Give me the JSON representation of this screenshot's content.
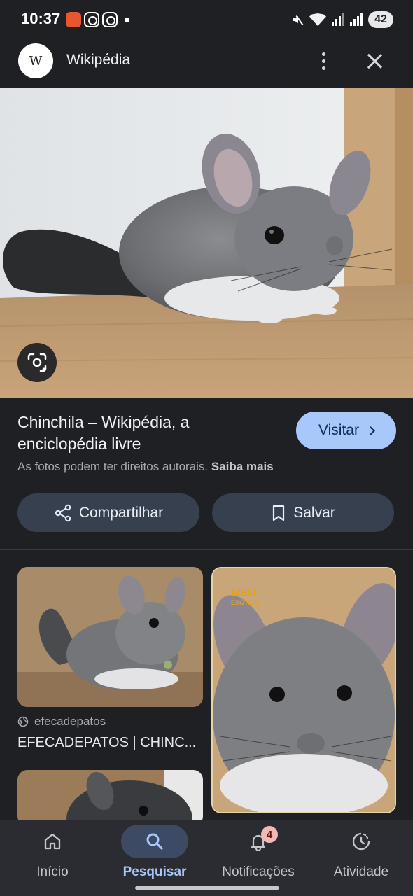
{
  "status_bar": {
    "time": "10:37",
    "battery": "42",
    "icons": [
      "app-notification-icon",
      "instagram-icon",
      "instagram-icon",
      "dot-icon",
      "mute-icon",
      "wifi-icon",
      "signal-icon",
      "signal-icon"
    ]
  },
  "header": {
    "logo_letter": "W",
    "title": "Wikipédia"
  },
  "result": {
    "title": "Chinchila – Wikipédia, a enciclopédia livre",
    "visit_label": "Visitar",
    "copyright_text": "As fotos podem ter direitos autorais.",
    "learn_more": "Saiba mais"
  },
  "actions": {
    "share_label": "Compartilhar",
    "save_label": "Salvar"
  },
  "related": {
    "item1": {
      "source": "efecadepatos",
      "title": "EFECADEPATOS | CHINC..."
    },
    "item2": {
      "overlay_logo_line1": "MEU",
      "overlay_logo_line2": "EXÓTICO"
    }
  },
  "nav": {
    "items": [
      {
        "label": "Início",
        "icon": "home-icon"
      },
      {
        "label": "Pesquisar",
        "icon": "search-icon"
      },
      {
        "label": "Notificações",
        "icon": "bell-icon",
        "badge": "4"
      },
      {
        "label": "Atividade",
        "icon": "activity-icon"
      }
    ],
    "active": "Pesquisar"
  },
  "colors": {
    "background": "#1f2024",
    "accent": "#a8c7fa",
    "button_bg": "#36404f",
    "nav_bg": "#2a2c31"
  }
}
